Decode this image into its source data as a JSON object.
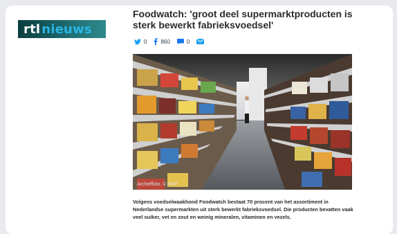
{
  "brand": {
    "logo_rtl": "rtl",
    "logo_nieuws": "nieuws"
  },
  "article": {
    "headline": "Foodwatch: 'groot deel supermarktproducten is sterk bewerkt fabrieksvoedsel'",
    "share": {
      "twitter_count": "0",
      "facebook_count": "860",
      "comments_count": "0"
    },
    "image_caption": "Archieffoto. © ANP",
    "intro": "Volgens voedselwaakhond Foodwatch bestaat 70 procent van het assortiment in Nederlandse supermarkten uit sterk bewerkt fabrieksvoedsel. Die producten bevatten vaak veel suiker, vet en zout en weinig mineralen, vitaminen en vezels."
  },
  "icons": {
    "twitter": "twitter-icon",
    "facebook": "facebook-icon",
    "comment": "comment-icon",
    "mail": "mail-icon"
  },
  "colors": {
    "social_blue": "#1da1f2",
    "facebook_blue": "#1877f2",
    "logo_teal": "#1f6e73",
    "logo_accent": "#2bb6e6"
  }
}
